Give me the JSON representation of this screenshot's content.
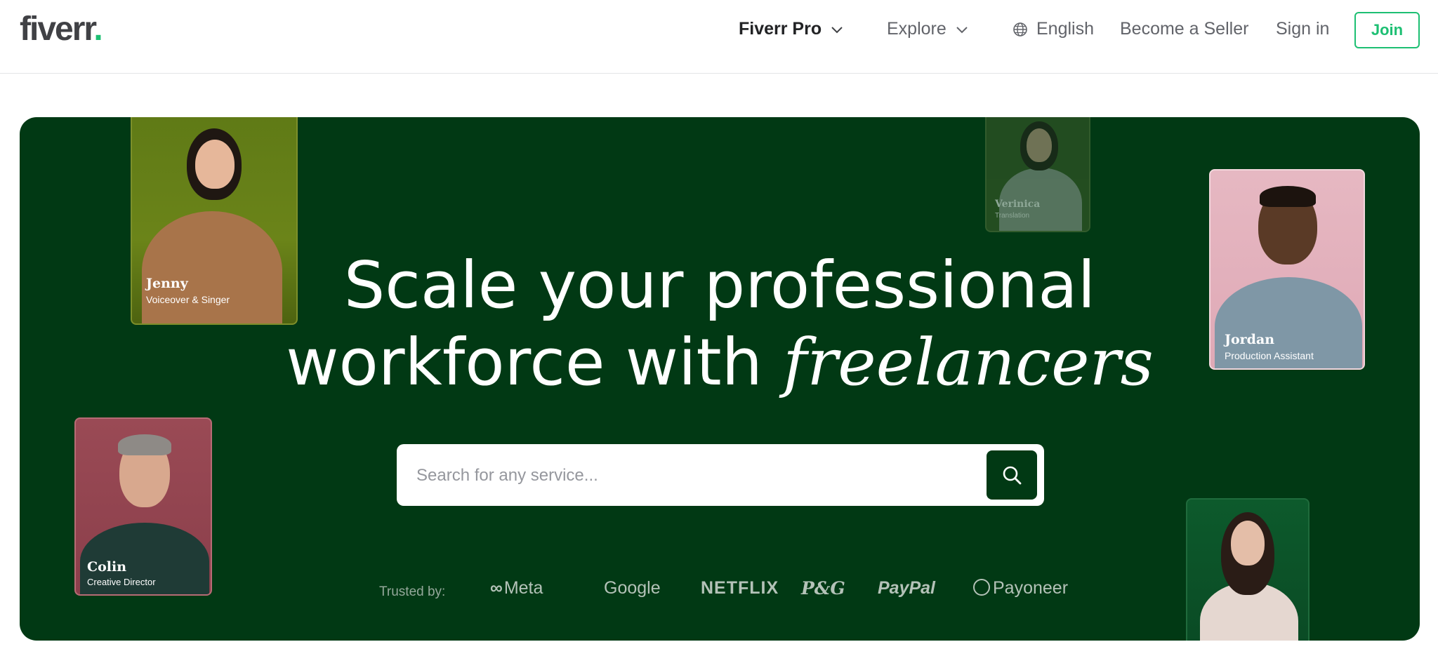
{
  "header": {
    "logo_text": "fiverr",
    "logo_dot": ".",
    "nav": {
      "fiverr_pro": "Fiverr Pro",
      "explore": "Explore",
      "language": "English",
      "become_seller": "Become a Seller",
      "sign_in": "Sign in",
      "join": "Join"
    }
  },
  "hero": {
    "headline_line1": "Scale your professional",
    "headline_line2_prefix": "workforce with",
    "headline_line2_italic": "freelancers",
    "search": {
      "placeholder": "Search for any service..."
    },
    "trusted_label": "Trusted by:",
    "brands": [
      "Meta",
      "Google",
      "NETFLIX",
      "P&G",
      "PayPal",
      "Payoneer"
    ],
    "freelancers": [
      {
        "name": "Jenny",
        "role": "Voiceover & Singer"
      },
      {
        "name": "Verinica",
        "role": "Translation"
      },
      {
        "name": "Jordan",
        "role": "Production Assistant"
      },
      {
        "name": "Colin",
        "role": "Creative Director"
      }
    ]
  },
  "colors": {
    "brand_green": "#1dbf73",
    "hero_bg": "#013914",
    "text_dark": "#404145",
    "text_muted": "#62646a"
  }
}
